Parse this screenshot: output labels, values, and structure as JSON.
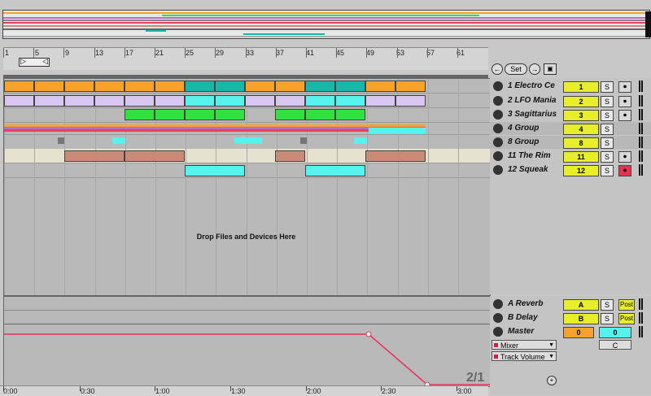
{
  "ruler": {
    "bars": [
      "1",
      "5",
      "9",
      "13",
      "17",
      "21",
      "25",
      "29",
      "33",
      "37",
      "41",
      "45",
      "49",
      "53",
      "57",
      "61"
    ]
  },
  "session": {
    "set_label": "Set"
  },
  "tracks": [
    {
      "name": "1 Electro Ce",
      "num": "1",
      "solo": "S",
      "arm": "⏺",
      "group": false,
      "arm_on": false
    },
    {
      "name": "2 LFO Mania",
      "num": "2",
      "solo": "S",
      "arm": "⏺",
      "group": false,
      "arm_on": false
    },
    {
      "name": "3 Sagittarius",
      "num": "3",
      "solo": "S",
      "arm": "⏺",
      "group": false,
      "arm_on": false
    },
    {
      "name": "4 Group",
      "num": "4",
      "solo": "S",
      "arm": "",
      "group": true,
      "arm_on": false
    },
    {
      "name": "8 Group",
      "num": "8",
      "solo": "S",
      "arm": "",
      "group": true,
      "arm_on": false
    },
    {
      "name": "11 The Rim",
      "num": "11",
      "solo": "S",
      "arm": "⏺",
      "group": false,
      "arm_on": false
    },
    {
      "name": "12 Squeak",
      "num": "12",
      "solo": "S",
      "arm": "⏺",
      "group": false,
      "arm_on": true
    }
  ],
  "arrangement": {
    "drop_text": "Drop Files and Devices Here"
  },
  "returns": [
    {
      "name": "A Reverb",
      "num": "A",
      "solo": "S",
      "post": "Post"
    },
    {
      "name": "B Delay",
      "num": "B",
      "solo": "S",
      "post": "Post"
    }
  ],
  "master": {
    "name": "Master",
    "volume": "0",
    "pan": "0",
    "pan_mode": "C",
    "device_chooser": "Mixer",
    "param_chooser": "Track Volume"
  },
  "timeline": {
    "labels": [
      "0:00",
      "0:30",
      "1:00",
      "1:30",
      "2:00",
      "2:30",
      "3:00"
    ]
  },
  "scene_count": "2/1",
  "colors": {
    "orange": "#f7a22a",
    "lavender": "#d9c6f2",
    "green": "#32e040",
    "teal": "#19b7a8",
    "cyan": "#56f3ee",
    "salmon": "#c88b78",
    "cream": "#e6e2d0",
    "automation": "#e8305a",
    "track_yellow": "#e8ef2a",
    "arm_red": "#e83050"
  }
}
